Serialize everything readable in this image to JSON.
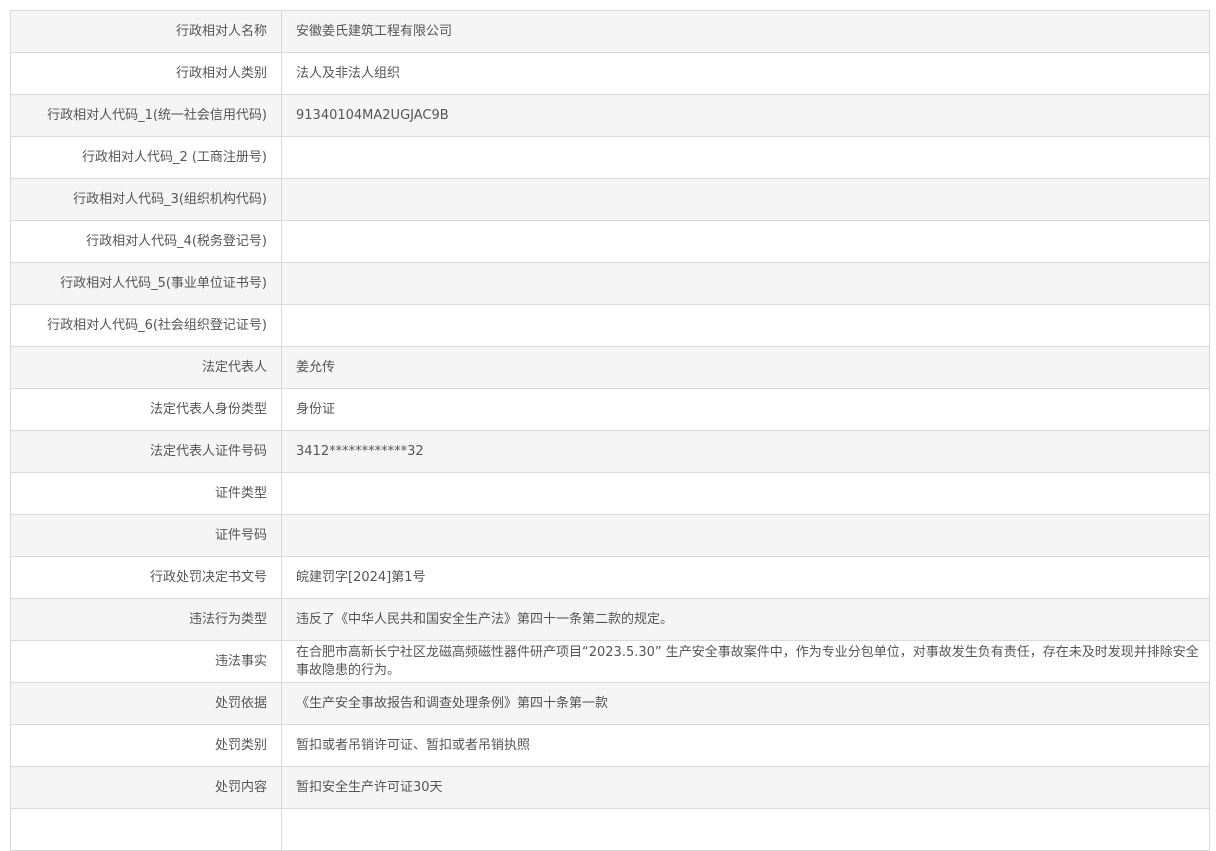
{
  "rows": [
    {
      "label": "行政相对人名称",
      "value": "安徽姜氏建筑工程有限公司"
    },
    {
      "label": "行政相对人类别",
      "value": "法人及非法人组织"
    },
    {
      "label": "行政相对人代码_1(统一社会信用代码)",
      "value": "91340104MA2UGJAC9B"
    },
    {
      "label": "行政相对人代码_2 (工商注册号)",
      "value": ""
    },
    {
      "label": "行政相对人代码_3(组织机构代码)",
      "value": ""
    },
    {
      "label": "行政相对人代码_4(税务登记号)",
      "value": ""
    },
    {
      "label": "行政相对人代码_5(事业单位证书号)",
      "value": ""
    },
    {
      "label": "行政相对人代码_6(社会组织登记证号)",
      "value": ""
    },
    {
      "label": "法定代表人",
      "value": "姜允传"
    },
    {
      "label": "法定代表人身份类型",
      "value": "身份证"
    },
    {
      "label": "法定代表人证件号码",
      "value": "3412************32"
    },
    {
      "label": "证件类型",
      "value": ""
    },
    {
      "label": "证件号码",
      "value": ""
    },
    {
      "label": "行政处罚决定书文号",
      "value": "皖建罚字[2024]第1号"
    },
    {
      "label": "违法行为类型",
      "value": "违反了《中华人民共和国安全生产法》第四十一条第二款的规定。"
    },
    {
      "label": "违法事实",
      "value": "在合肥市高新长宁社区龙磁高频磁性器件研产项目“2023.5.30” 生产安全事故案件中，作为专业分包单位，对事故发生负有责任，存在未及时发现并排除安全事故隐患的行为。"
    },
    {
      "label": "处罚依据",
      "value": "《生产安全事故报告和调查处理条例》第四十条第一款"
    },
    {
      "label": "处罚类别",
      "value": "暂扣或者吊销许可证、暂扣或者吊销执照"
    },
    {
      "label": "处罚内容",
      "value": "暂扣安全生产许可证30天"
    },
    {
      "label": "",
      "value": ""
    }
  ]
}
